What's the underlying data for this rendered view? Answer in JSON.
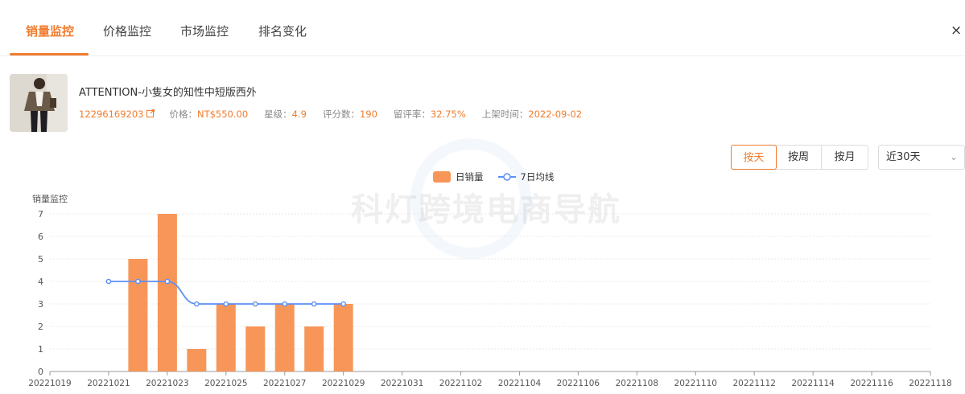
{
  "tabs": [
    "销量监控",
    "价格监控",
    "市场监控",
    "排名变化"
  ],
  "close_label": "×",
  "product": {
    "title": "ATTENTION-小隻女的知性中短版西外",
    "id": "12296169203",
    "price_label": "价格：",
    "price": "NT$550.00",
    "rating_label": "星级：",
    "rating": "4.9",
    "reviews_label": "评分数：",
    "reviews": "190",
    "review_rate_label": "留评率：",
    "review_rate": "32.75%",
    "listed_label": "上架时间：",
    "listed": "2022-09-02"
  },
  "controls": {
    "granularity": [
      "按天",
      "按周",
      "按月"
    ],
    "active": "按天",
    "range": "近30天"
  },
  "watermark": "科灯跨境电商导航",
  "colors": {
    "accent": "#f07c2e",
    "bar": "#f79658",
    "line": "#5b8ff9"
  },
  "chart_data": {
    "type": "bar",
    "ylabel": "销量监控",
    "ylim": [
      0,
      7
    ],
    "yticks": [
      0,
      1,
      2,
      3,
      4,
      5,
      6,
      7
    ],
    "grid": true,
    "legend_position": "top-center",
    "xticks": [
      "20221019",
      "20221021",
      "20221023",
      "20221025",
      "20221027",
      "20221029",
      "20221031",
      "20221102",
      "20221104",
      "20221106",
      "20221108",
      "20221110",
      "20221112",
      "20221114",
      "20221116",
      "20221118"
    ],
    "series": [
      {
        "name": "日销量",
        "type": "bar",
        "x": [
          "20221022",
          "20221023",
          "20221024",
          "20221025",
          "20221026",
          "20221027",
          "20221028",
          "20221029"
        ],
        "values": [
          5,
          7,
          1,
          3,
          2,
          3,
          2,
          3
        ]
      },
      {
        "name": "7日均线",
        "type": "line",
        "x": [
          "20221021",
          "20221022",
          "20221023",
          "20221024",
          "20221025",
          "20221026",
          "20221027",
          "20221028",
          "20221029"
        ],
        "values": [
          4,
          4,
          4,
          3,
          3,
          3,
          3,
          3,
          3
        ]
      }
    ]
  }
}
